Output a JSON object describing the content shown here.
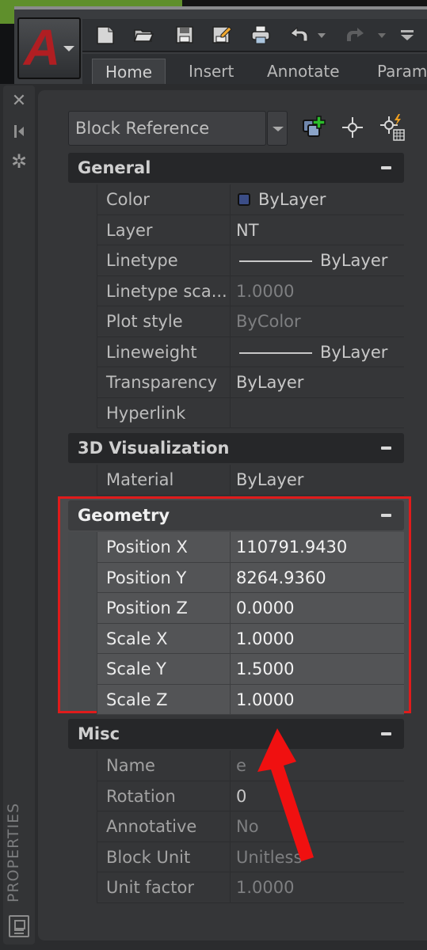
{
  "app": {
    "logo_letter": "A",
    "quick_access": [
      "new-icon",
      "open-icon",
      "save-icon",
      "save-as-icon",
      "plot-icon",
      "undo-icon",
      "redo-icon",
      "customize-icon"
    ]
  },
  "ribbon": {
    "tabs": [
      {
        "label": "Home",
        "active": true
      },
      {
        "label": "Insert",
        "active": false
      },
      {
        "label": "Annotate",
        "active": false
      },
      {
        "label": "Param",
        "active": false
      }
    ]
  },
  "palette": {
    "title": "PROPERTIES",
    "side_icons": [
      "close-icon",
      "auto-hide-icon",
      "settings-icon"
    ],
    "selector": {
      "value": "Block Reference"
    },
    "tools": [
      "toggle-pickadd-icon",
      "select-objects-icon",
      "quick-select-icon"
    ],
    "sections": {
      "general": {
        "title": "General",
        "rows": [
          {
            "label": "Color",
            "value": "ByLayer",
            "swatch": "#3b4d86"
          },
          {
            "label": "Layer",
            "value": "NT"
          },
          {
            "label": "Linetype",
            "value": "ByLayer"
          },
          {
            "label": "Linetype sca...",
            "value": "1.0000"
          },
          {
            "label": "Plot style",
            "value": "ByColor"
          },
          {
            "label": "Lineweight",
            "value": "ByLayer"
          },
          {
            "label": "Transparency",
            "value": "ByLayer"
          },
          {
            "label": "Hyperlink",
            "value": ""
          }
        ]
      },
      "visualization": {
        "title": "3D Visualization",
        "rows": [
          {
            "label": "Material",
            "value": "ByLayer"
          }
        ]
      },
      "geometry": {
        "title": "Geometry",
        "rows": [
          {
            "label": "Position X",
            "value": "110791.9430"
          },
          {
            "label": "Position Y",
            "value": "8264.9360"
          },
          {
            "label": "Position Z",
            "value": "0.0000"
          },
          {
            "label": "Scale X",
            "value": "1.0000"
          },
          {
            "label": "Scale Y",
            "value": "1.5000"
          },
          {
            "label": "Scale Z",
            "value": "1.0000"
          }
        ]
      },
      "misc": {
        "title": "Misc",
        "rows": [
          {
            "label": "Name",
            "value": "e"
          },
          {
            "label": "Rotation",
            "value": "0"
          },
          {
            "label": "Annotative",
            "value": "No"
          },
          {
            "label": "Block Unit",
            "value": "Unitless"
          },
          {
            "label": "Unit factor",
            "value": "1.0000"
          }
        ]
      }
    }
  },
  "annotation": {
    "highlight_color": "#e01b1b",
    "highlight_target": "Geometry"
  }
}
